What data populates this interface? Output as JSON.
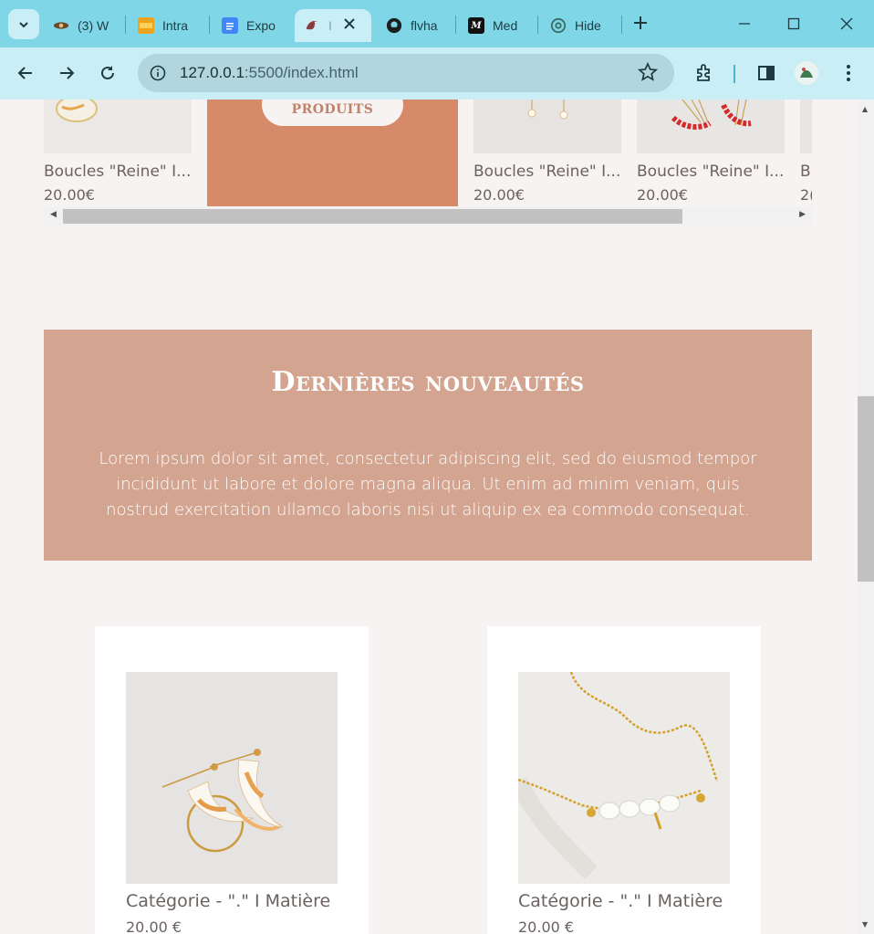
{
  "browser": {
    "tabs": [
      {
        "title": "(3) W",
        "favicon": "eye-favicon"
      },
      {
        "title": "Intra",
        "favicon": "intranet-favicon"
      },
      {
        "title": "Expo",
        "favicon": "docs-favicon"
      },
      {
        "title": "I",
        "favicon": "bird-favicon"
      },
      {
        "title": "flvha",
        "favicon": "github-favicon"
      },
      {
        "title": "Med",
        "favicon": "medium-favicon"
      },
      {
        "title": "Hide",
        "favicon": "openai-favicon"
      }
    ],
    "url_host": "127.0.0.1",
    "url_rest": ":5500/index.html",
    "accent": "#7fd6e6"
  },
  "carousel": {
    "promo_button": "PRODUITS",
    "items": [
      {
        "name": "Boucles \"Reine\" I...",
        "price": "20.00€"
      },
      {
        "name": "Boucles \"Reine\" I...",
        "price": "20.00€"
      },
      {
        "name": "Boucles \"Reine\" I...",
        "price": "20.00€"
      },
      {
        "name": "B",
        "price": "2("
      }
    ]
  },
  "banner": {
    "title": "Dernières nouveautés",
    "text": "Lorem ipsum dolor sit amet, consectetur adipiscing elit, sed do eiusmod tempor incididunt ut labore et dolore magna aliqua. Ut enim ad minim veniam, quis nostrud exercitation ullamco laboris nisi ut aliquip ex ea commodo consequat.",
    "color": "#d3a490"
  },
  "products": [
    {
      "category": "Catégorie - \".\" I Matière",
      "price": "20.00 €"
    },
    {
      "category": "Catégorie - \".\" I Matière",
      "price": "20.00 €"
    }
  ]
}
